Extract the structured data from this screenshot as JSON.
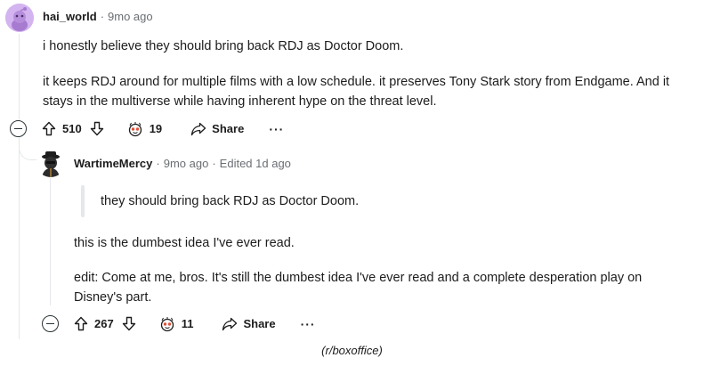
{
  "comment1": {
    "username": "hai_world",
    "time": "9mo ago",
    "body": [
      "i honestly believe they should bring back RDJ as Doctor Doom.",
      "it keeps RDJ around for multiple films with a low schedule. it preserves Tony Stark story from Endgame. And it stays in the multiverse while having inherent hype on the threat level."
    ],
    "upvotes": "510",
    "awards": "19",
    "share_label": "Share",
    "more_label": "···"
  },
  "comment2": {
    "username": "WartimeMercy",
    "time": "9mo ago",
    "edited": "Edited 1d ago",
    "quote": "they should bring back RDJ as Doctor Doom.",
    "body": [
      "this is the dumbest idea I've ever read.",
      "edit: Come at me, bros. It's still the dumbest idea I've ever read and a complete desperation play on Disney's part."
    ],
    "upvotes": "267",
    "awards": "11",
    "share_label": "Share",
    "more_label": "···"
  },
  "caption": "(r/boxoffice)",
  "colors": {
    "meta": "#6a6f74",
    "thread_line": "#e5e7ea",
    "avatar1_bg": "#d3b4f0"
  }
}
